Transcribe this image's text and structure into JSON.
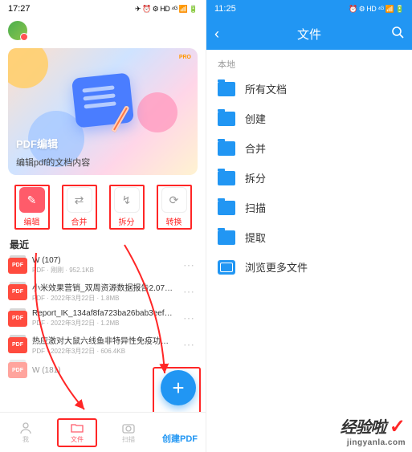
{
  "left": {
    "status_time": "17:27",
    "status_icons": "✈ ⏰ ⚙ HD ⁴ᴳ 📶 🔋",
    "hero_badge": "PRO",
    "hero_title": "PDF编辑",
    "hero_sub": "编辑pdf的文档内容",
    "actions": [
      {
        "label": "编辑",
        "icon": "✎"
      },
      {
        "label": "合并",
        "icon": "⇄"
      },
      {
        "label": "拆分",
        "icon": "↯"
      },
      {
        "label": "转换",
        "icon": "⟳"
      }
    ],
    "recent_title": "最近",
    "files": [
      {
        "name": "W (107)",
        "meta": "PDF · 刚刚 · 952.1KB"
      },
      {
        "name": "小米效果营销_双周资源数据报告2.07-…",
        "meta": "PDF · 2022年3月22日 · 1.8MB"
      },
      {
        "name": "Report_IK_134af8fa723ba26bab3eef…",
        "meta": "PDF · 2022年3月22日 · 1.2MB"
      },
      {
        "name": "热应激对大鼠六线鱼非特异性免疫功…",
        "meta": "PDF · 2022年3月22日 · 606.4KB"
      },
      {
        "name": "W (181)",
        "meta": ""
      }
    ],
    "nav": [
      {
        "label": "我",
        "icon": "user"
      },
      {
        "label": "文件",
        "icon": "folder"
      },
      {
        "label": "扫描",
        "icon": "camera"
      },
      {
        "label": "创建PDF",
        "icon": ""
      }
    ],
    "fab": "+"
  },
  "right": {
    "status_time": "11:25",
    "status_icons": "⏰ ⚙ HD ⁴ᴳ 📶 🔋",
    "header_title": "文件",
    "section_label": "本地",
    "folders": [
      {
        "label": "所有文档"
      },
      {
        "label": "创建"
      },
      {
        "label": "合并"
      },
      {
        "label": "拆分"
      },
      {
        "label": "扫描"
      },
      {
        "label": "提取"
      }
    ],
    "browse_more": "浏览更多文件"
  },
  "watermark": {
    "main": "经验啦",
    "check": "✓",
    "sub": "jingyanla.com"
  }
}
